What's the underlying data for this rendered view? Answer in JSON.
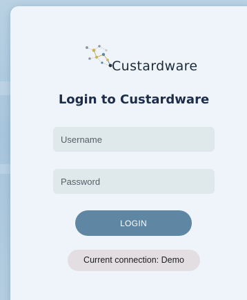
{
  "brand": {
    "name": "Custardware",
    "logo_icon": "network-nodes-logo",
    "colors": {
      "node_gray": "#8e98a2",
      "node_gold": "#c9b458",
      "node_blue": "#5f86a2",
      "node_dark": "#2a3442"
    }
  },
  "login": {
    "title": "Login to Custardware",
    "username_placeholder": "Username",
    "username_value": "",
    "password_placeholder": "Password",
    "password_value": "",
    "login_label": "LOGIN"
  },
  "status": {
    "connection_text": "Current connection: Demo"
  },
  "theme": {
    "accent": "#5f86a2",
    "field_bg": "#dfe9ec",
    "card_bg": "#eef4fa",
    "badge_bg": "#e2dee2"
  }
}
